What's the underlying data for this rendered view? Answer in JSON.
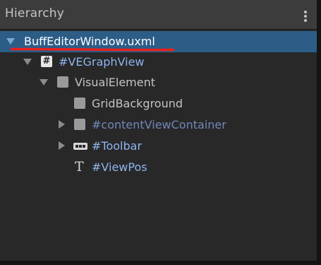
{
  "panel": {
    "title": "Hierarchy",
    "menu_icon": "kebab-menu-icon"
  },
  "tree": {
    "root": {
      "label": "BuffEditorWindow.uxml",
      "expanded": true,
      "selected": true
    },
    "graph_view": {
      "label": "#VEGraphView",
      "icon": "hash-icon",
      "expanded": true
    },
    "visual_element": {
      "label": "VisualElement",
      "icon": "visual-element-icon",
      "expanded": true
    },
    "grid_background": {
      "label": "GridBackground",
      "icon": "visual-element-icon"
    },
    "content_view_container": {
      "label": "#contentViewContainer",
      "icon": "visual-element-icon",
      "expanded": false
    },
    "toolbar": {
      "label": "#Toolbar",
      "icon": "toolbar-icon",
      "expanded": false
    },
    "view_pos": {
      "label": "#ViewPos",
      "icon": "text-icon"
    }
  },
  "annotation": {
    "underline_color": "#e8201c"
  },
  "colors": {
    "selection": "#2c5d87",
    "named_element_text": "#8fb4ee",
    "dimmed_named_text": "#7088b8",
    "plain_text": "#c4c4c4",
    "selected_text": "#ffffff"
  }
}
